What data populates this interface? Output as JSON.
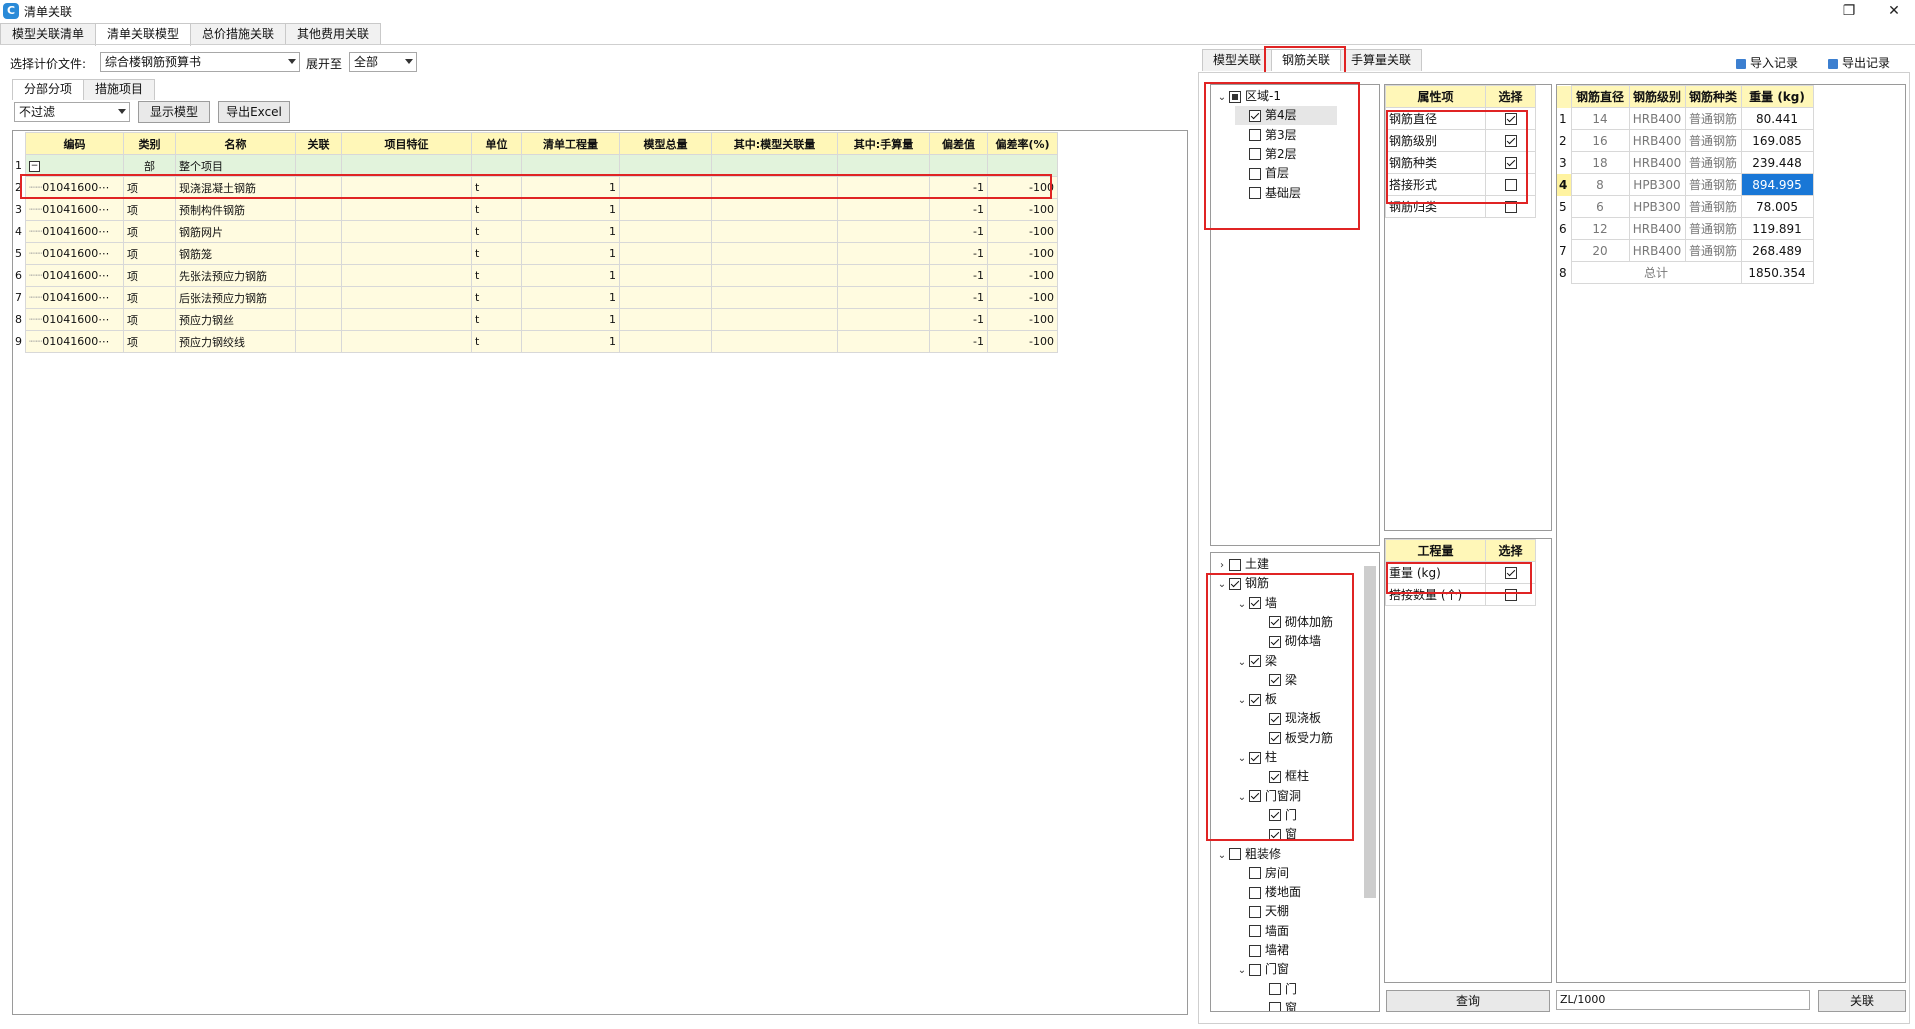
{
  "window": {
    "title": "清单关联",
    "app_icon_letter": "C",
    "restore_glyph": "❐",
    "close_glyph": "✕"
  },
  "tabs": [
    "模型关联清单",
    "清单关联模型",
    "总价措施关联",
    "其他费用关联"
  ],
  "toolbar": {
    "file_label": "选择计价文件:",
    "file_value": "综合楼钢筋预算书",
    "expand_label": "展开至",
    "expand_value": "全部"
  },
  "subtabs": [
    "分部分项",
    "措施项目"
  ],
  "filter": {
    "value": "不过滤",
    "show_model_label": "显示模型",
    "export_label": "导出Excel"
  },
  "bill_table": {
    "columns": [
      "编码",
      "类别",
      "名称",
      "关联",
      "项目特征",
      "单位",
      "清单工程量",
      "模型总量",
      "其中:模型关联量",
      "其中:手算量",
      "偏差值",
      "偏差率(%)"
    ],
    "rows": [
      {
        "n": "1",
        "code": "",
        "type": "部",
        "name": "整个项目",
        "unit": "",
        "qty": "",
        "dev": "",
        "rate": "",
        "group": true
      },
      {
        "n": "2",
        "code": "01041600⋯",
        "type": "项",
        "name": "现浇混凝土钢筋",
        "unit": "t",
        "qty": "1",
        "dev": "-1",
        "rate": "-100"
      },
      {
        "n": "3",
        "code": "01041600⋯",
        "type": "项",
        "name": "预制构件钢筋",
        "unit": "t",
        "qty": "1",
        "dev": "-1",
        "rate": "-100"
      },
      {
        "n": "4",
        "code": "01041600⋯",
        "type": "项",
        "name": "钢筋网片",
        "unit": "t",
        "qty": "1",
        "dev": "-1",
        "rate": "-100"
      },
      {
        "n": "5",
        "code": "01041600⋯",
        "type": "项",
        "name": "钢筋笼",
        "unit": "t",
        "qty": "1",
        "dev": "-1",
        "rate": "-100"
      },
      {
        "n": "6",
        "code": "01041600⋯",
        "type": "项",
        "name": "先张法预应力钢筋",
        "unit": "t",
        "qty": "1",
        "dev": "-1",
        "rate": "-100"
      },
      {
        "n": "7",
        "code": "01041600⋯",
        "type": "项",
        "name": "后张法预应力钢筋",
        "unit": "t",
        "qty": "1",
        "dev": "-1",
        "rate": "-100"
      },
      {
        "n": "8",
        "code": "01041600⋯",
        "type": "项",
        "name": "预应力钢丝",
        "unit": "t",
        "qty": "1",
        "dev": "-1",
        "rate": "-100"
      },
      {
        "n": "9",
        "code": "01041600⋯",
        "type": "项",
        "name": "预应力钢绞线",
        "unit": "t",
        "qty": "1",
        "dev": "-1",
        "rate": "-100"
      }
    ]
  },
  "right_tabs": [
    "模型关联",
    "钢筋关联",
    "手算量关联"
  ],
  "import_label": "导入记录",
  "export_record_label": "导出记录",
  "floor_tree": [
    {
      "label": "区域-1",
      "depth": 0,
      "state": "partial",
      "caret": "⌄"
    },
    {
      "label": "第4层",
      "depth": 1,
      "state": "checked",
      "selected": true
    },
    {
      "label": "第3层",
      "depth": 1,
      "state": "none"
    },
    {
      "label": "第2层",
      "depth": 1,
      "state": "none"
    },
    {
      "label": "首层",
      "depth": 1,
      "state": "none"
    },
    {
      "label": "基础层",
      "depth": 1,
      "state": "none"
    }
  ],
  "component_tree": [
    {
      "label": "土建",
      "depth": 0,
      "state": "none",
      "caret": "›"
    },
    {
      "label": "钢筋",
      "depth": 0,
      "state": "checked",
      "caret": "⌄"
    },
    {
      "label": "墙",
      "depth": 1,
      "state": "checked",
      "caret": "⌄"
    },
    {
      "label": "砌体加筋",
      "depth": 2,
      "state": "checked"
    },
    {
      "label": "砌体墙",
      "depth": 2,
      "state": "checked"
    },
    {
      "label": "梁",
      "depth": 1,
      "state": "checked",
      "caret": "⌄"
    },
    {
      "label": "梁",
      "depth": 2,
      "state": "checked"
    },
    {
      "label": "板",
      "depth": 1,
      "state": "checked",
      "caret": "⌄"
    },
    {
      "label": "现浇板",
      "depth": 2,
      "state": "checked"
    },
    {
      "label": "板受力筋",
      "depth": 2,
      "state": "checked"
    },
    {
      "label": "柱",
      "depth": 1,
      "state": "checked",
      "caret": "⌄"
    },
    {
      "label": "框柱",
      "depth": 2,
      "state": "checked"
    },
    {
      "label": "门窗洞",
      "depth": 1,
      "state": "checked",
      "caret": "⌄"
    },
    {
      "label": "门",
      "depth": 2,
      "state": "checked"
    },
    {
      "label": "窗",
      "depth": 2,
      "state": "checked"
    },
    {
      "label": "粗装修",
      "depth": 0,
      "state": "none",
      "caret": "⌄"
    },
    {
      "label": "房间",
      "depth": 1,
      "state": "none"
    },
    {
      "label": "楼地面",
      "depth": 1,
      "state": "none"
    },
    {
      "label": "天棚",
      "depth": 1,
      "state": "none"
    },
    {
      "label": "墙面",
      "depth": 1,
      "state": "none"
    },
    {
      "label": "墙裙",
      "depth": 1,
      "state": "none"
    },
    {
      "label": "门窗",
      "depth": 1,
      "state": "none",
      "caret": "⌄"
    },
    {
      "label": "门",
      "depth": 2,
      "state": "none"
    },
    {
      "label": "窗",
      "depth": 2,
      "state": "none"
    }
  ],
  "attr_table": {
    "headers": [
      "属性项",
      "选择"
    ],
    "rows": [
      {
        "label": "钢筋直径",
        "checked": true
      },
      {
        "label": "钢筋级别",
        "checked": true
      },
      {
        "label": "钢筋种类",
        "checked": true
      },
      {
        "label": "搭接形式",
        "checked": false
      },
      {
        "label": "钢筋归类",
        "checked": false
      }
    ]
  },
  "qty_table": {
    "headers": [
      "工程量",
      "选择"
    ],
    "rows": [
      {
        "label": "重量 (kg)",
        "checked": true
      },
      {
        "label": "搭接数量 (个)",
        "checked": false
      }
    ]
  },
  "query_label": "查询",
  "result_table": {
    "headers": [
      "钢筋直径",
      "钢筋级别",
      "钢筋种类",
      "重量 (kg)"
    ],
    "rows": [
      {
        "n": "1",
        "d": "14",
        "g": "HRB400",
        "t": "普通钢筋",
        "w": "80.441"
      },
      {
        "n": "2",
        "d": "16",
        "g": "HRB400",
        "t": "普通钢筋",
        "w": "169.085"
      },
      {
        "n": "3",
        "d": "18",
        "g": "HRB400",
        "t": "普通钢筋",
        "w": "239.448"
      },
      {
        "n": "4",
        "d": "8",
        "g": "HPB300",
        "t": "普通钢筋",
        "w": "894.995",
        "selected": true
      },
      {
        "n": "5",
        "d": "6",
        "g": "HPB300",
        "t": "普通钢筋",
        "w": "78.005"
      },
      {
        "n": "6",
        "d": "12",
        "g": "HRB400",
        "t": "普通钢筋",
        "w": "119.891"
      },
      {
        "n": "7",
        "d": "20",
        "g": "HRB400",
        "t": "普通钢筋",
        "w": "268.489"
      }
    ],
    "total_n": "8",
    "total_label": "总计",
    "total_value": "1850.354"
  },
  "formula_value": "ZL/1000",
  "link_label": "关联",
  "colors": {
    "highlight": "#e02424",
    "header_bg": "#fff7b8",
    "selection": "#1977d6"
  }
}
